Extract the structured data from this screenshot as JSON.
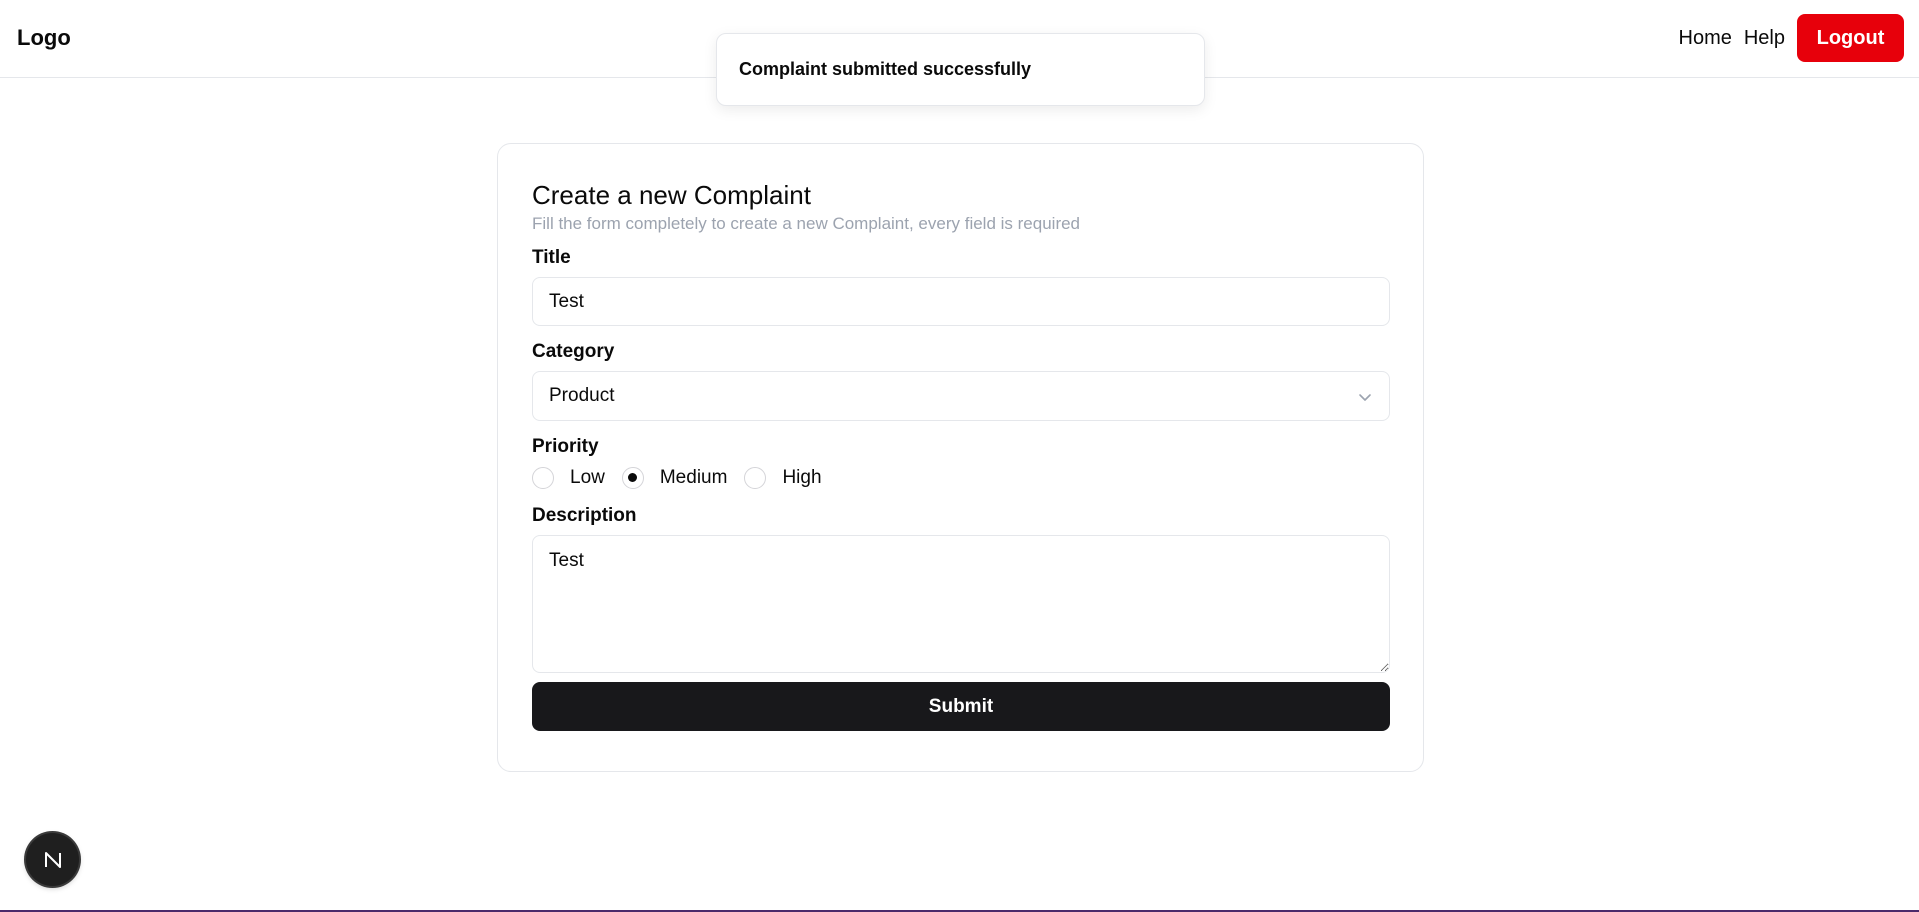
{
  "header": {
    "logo": "Logo",
    "nav": {
      "home": "Home",
      "help": "Help",
      "logout": "Logout"
    }
  },
  "toast": {
    "message": "Complaint submitted successfully"
  },
  "form": {
    "title": "Create a new Complaint",
    "subtitle": "Fill the form completely to create a new Complaint, every field is required",
    "title_field": {
      "label": "Title",
      "value": "Test"
    },
    "category_field": {
      "label": "Category",
      "selected": "Product"
    },
    "priority_field": {
      "label": "Priority",
      "options": [
        "Low",
        "Medium",
        "High"
      ],
      "selected": "Medium"
    },
    "description_field": {
      "label": "Description",
      "value": "Test"
    },
    "submit_label": "Submit"
  },
  "badge": {
    "letter": "N"
  },
  "colors": {
    "logout_bg": "#e7000b",
    "submit_bg": "#18181b",
    "muted_text": "#9ca3af"
  }
}
